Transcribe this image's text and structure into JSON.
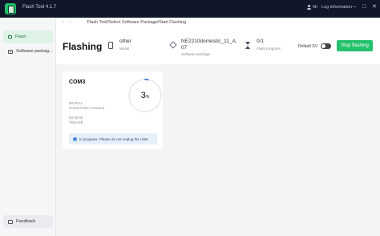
{
  "window": {
    "title": "Flash Tool 4.1.7",
    "user": "hh",
    "log_label": "Log information",
    "min_glyph": "–",
    "max_glyph": "□",
    "close_glyph": "✕"
  },
  "sidebar": {
    "items": [
      {
        "label": "Flash",
        "active": true
      },
      {
        "label": "Software packag..."
      }
    ],
    "feedback_label": "Feedback"
  },
  "breadcrumb": {
    "back_glyph": "‹",
    "forward_glyph": "›",
    "path": "Flash Tool/Select Software Package/Start Flashing"
  },
  "header": {
    "title": "Flashing",
    "device": {
      "value": "other",
      "label": "Model"
    },
    "package": {
      "value": "NE2210domestic_11_A.07",
      "label": "Software package"
    },
    "progress": {
      "value": "0/1",
      "label": "Flash progress"
    },
    "default_sv_label": "Default SV",
    "default_sv_on": false,
    "stop_label": "Stop flashing"
  },
  "device_card": {
    "port": "COM3",
    "percent": 3,
    "percent_text": "3",
    "percent_unit": "%",
    "elapsed_value": "00:00:11",
    "elapsed_label": "Current time consume",
    "remaining_value": "00:05:55",
    "remaining_label": "Time left",
    "notice": "In progress. Please do not unplug the USB."
  },
  "colors": {
    "titlebar": "#10172a",
    "accent": "#23c16b",
    "ring_progress": "#3a7bd5",
    "ring_track": "#e6e8eb"
  }
}
